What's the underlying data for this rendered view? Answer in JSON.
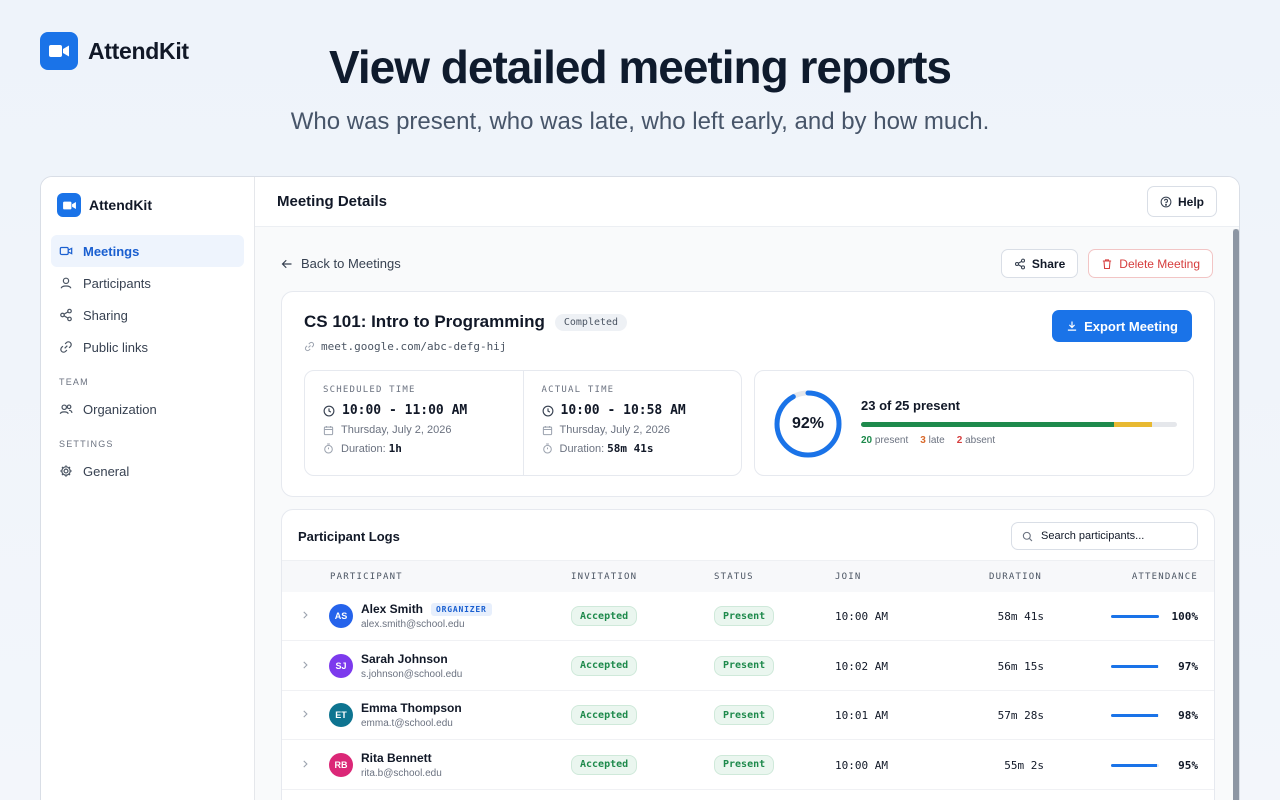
{
  "brand": {
    "name": "AttendKit",
    "accent": "#1a73e8"
  },
  "hero": {
    "title": "View detailed meeting reports",
    "subtitle": "Who was present, who was late, who left early, and by how much."
  },
  "sidebar": {
    "brand": "AttendKit",
    "items": [
      {
        "label": "Meetings",
        "icon": "video-icon",
        "active": true
      },
      {
        "label": "Participants",
        "icon": "user-icon"
      },
      {
        "label": "Sharing",
        "icon": "share-icon"
      },
      {
        "label": "Public links",
        "icon": "link-icon"
      }
    ],
    "team_label": "TEAM",
    "team_items": [
      {
        "label": "Organization",
        "icon": "users-icon"
      }
    ],
    "settings_label": "SETTINGS",
    "settings_items": [
      {
        "label": "General",
        "icon": "gear-icon"
      }
    ]
  },
  "topbar": {
    "title": "Meeting Details",
    "help_label": "Help"
  },
  "back": {
    "label": "Back to Meetings"
  },
  "actions": {
    "share": "Share",
    "delete": "Delete Meeting"
  },
  "meeting": {
    "title": "CS 101: Intro to Programming",
    "status": "Completed",
    "link": "meet.google.com/abc-defg-hij",
    "export_label": "Export Meeting",
    "scheduled": {
      "label": "SCHEDULED TIME",
      "time": "10:00 - 11:00 AM",
      "date": "Thursday, July 2, 2026",
      "duration_label": "Duration:",
      "duration": "1h"
    },
    "actual": {
      "label": "ACTUAL TIME",
      "time": "10:00 - 10:58 AM",
      "date": "Thursday, July 2, 2026",
      "duration_label": "Duration:",
      "duration": "58m 41s"
    },
    "attendance": {
      "percent_label": "92%",
      "percent": 0.92,
      "summary": "23 of 25 present",
      "present": 20,
      "present_label": "present",
      "late": 3,
      "late_label": "late",
      "absent": 2,
      "absent_label": "absent",
      "total": 25
    }
  },
  "logs": {
    "title": "Participant Logs",
    "search_placeholder": "Search participants...",
    "columns": {
      "participant": "PARTICIPANT",
      "invitation": "INVITATION",
      "status": "STATUS",
      "join": "JOIN",
      "duration": "DURATION",
      "attendance": "ATTENDANCE"
    },
    "rows": [
      {
        "initials": "AS",
        "avatar_color": "#2563eb",
        "name": "Alex Smith",
        "badge": "ORGANIZER",
        "email": "alex.smith@school.edu",
        "invitation": "Accepted",
        "status": "Present",
        "join": "10:00 AM",
        "duration": "58m 41s",
        "attendance": "100%",
        "attendance_value": 1.0
      },
      {
        "initials": "SJ",
        "avatar_color": "#7c3aed",
        "name": "Sarah Johnson",
        "badge": "",
        "email": "s.johnson@school.edu",
        "invitation": "Accepted",
        "status": "Present",
        "join": "10:02 AM",
        "duration": "56m 15s",
        "attendance": "97%",
        "attendance_value": 0.97
      },
      {
        "initials": "ET",
        "avatar_color": "#0e7490",
        "name": "Emma Thompson",
        "badge": "",
        "email": "emma.t@school.edu",
        "invitation": "Accepted",
        "status": "Present",
        "join": "10:01 AM",
        "duration": "57m 28s",
        "attendance": "98%",
        "attendance_value": 0.98
      },
      {
        "initials": "RB",
        "avatar_color": "#db2777",
        "name": "Rita Bennett",
        "badge": "",
        "email": "rita.b@school.edu",
        "invitation": "Accepted",
        "status": "Present",
        "join": "10:00 AM",
        "duration": "55m 2s",
        "attendance": "95%",
        "attendance_value": 0.95
      }
    ]
  }
}
